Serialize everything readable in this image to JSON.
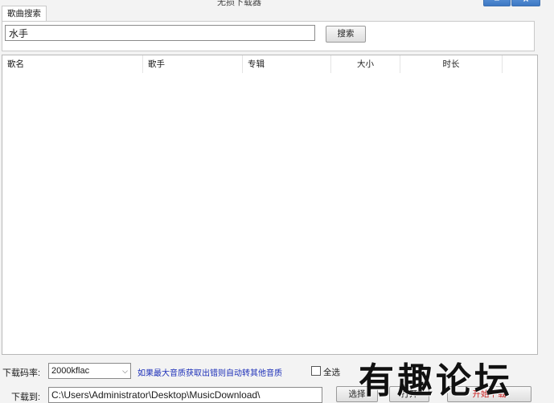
{
  "window": {
    "title": "无损下载器"
  },
  "tab": {
    "label": "歌曲搜索"
  },
  "search": {
    "value": "水手",
    "button": "搜索"
  },
  "table": {
    "columns": [
      "歌名",
      "歌手",
      "专辑",
      "大小",
      "时长"
    ],
    "rows": []
  },
  "footer": {
    "bitrate_label": "下载码率:",
    "bitrate_value": "2000kflac",
    "note": "如果最大音质获取出错则自动转其他音质",
    "select_all_label": "全选",
    "download_to_label": "下载到:",
    "path_value": "C:\\Users\\Administrator\\Desktop\\MusicDownload\\",
    "choose_button": "选择",
    "open_button": "打开",
    "start_button": "开始下载"
  },
  "watermark": {
    "text": "有趣论坛"
  }
}
